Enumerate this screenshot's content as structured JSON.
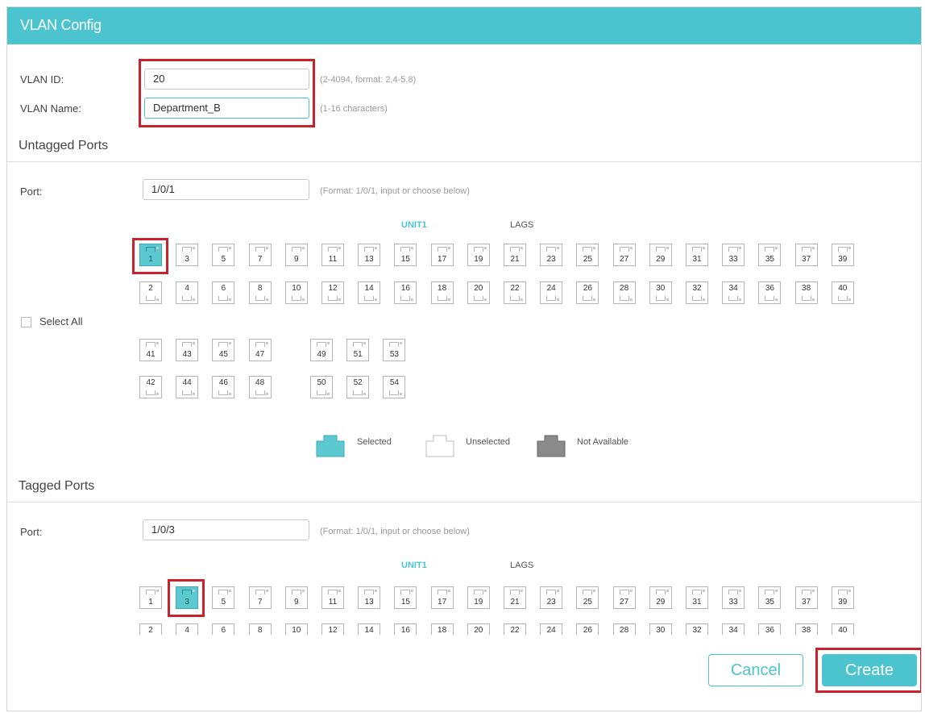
{
  "title": "VLAN Config",
  "vlan": {
    "id_label": "VLAN ID:",
    "id_value": "20",
    "id_hint": "(2-4094, format: 2,4-5,8)",
    "name_label": "VLAN Name:",
    "name_value": "Department_B",
    "name_hint": "(1-16 characters)"
  },
  "untagged": {
    "section_title": "Untagged Ports",
    "port_label": "Port:",
    "port_value": "1/0/1",
    "port_hint": "(Format: 1/0/1, input or choose below)",
    "unit_tab": "UNIT1",
    "lags_tab": "LAGS",
    "select_all_label": "Select All",
    "selected_ports": [
      1
    ]
  },
  "legend": {
    "selected": "Selected",
    "unselected": "Unselected",
    "not_available": "Not Available"
  },
  "tagged": {
    "section_title": "Tagged Ports",
    "port_label": "Port:",
    "port_value": "1/0/3",
    "port_hint": "(Format: 1/0/1, input or choose below)",
    "unit_tab": "UNIT1",
    "lags_tab": "LAGS",
    "selected_ports": [
      3
    ]
  },
  "ports": {
    "main_top": [
      "1",
      "3",
      "5",
      "7",
      "9",
      "11",
      "13",
      "15",
      "17",
      "19",
      "21",
      "23",
      "25",
      "27",
      "29",
      "31",
      "33",
      "35",
      "37",
      "39"
    ],
    "main_bottom": [
      "2",
      "4",
      "6",
      "8",
      "10",
      "12",
      "14",
      "16",
      "18",
      "20",
      "22",
      "24",
      "26",
      "28",
      "30",
      "32",
      "34",
      "36",
      "38",
      "40"
    ],
    "group_a_top": [
      "41",
      "43",
      "45",
      "47"
    ],
    "group_a_bottom": [
      "42",
      "44",
      "46",
      "48"
    ],
    "group_b_top": [
      "49",
      "51",
      "53"
    ],
    "group_b_bottom": [
      "50",
      "52",
      "54"
    ]
  },
  "buttons": {
    "cancel": "Cancel",
    "create": "Create"
  },
  "colors": {
    "accent": "#4bc4cf",
    "highlight": "#c8232c",
    "not_available": "#8a8a8a"
  }
}
